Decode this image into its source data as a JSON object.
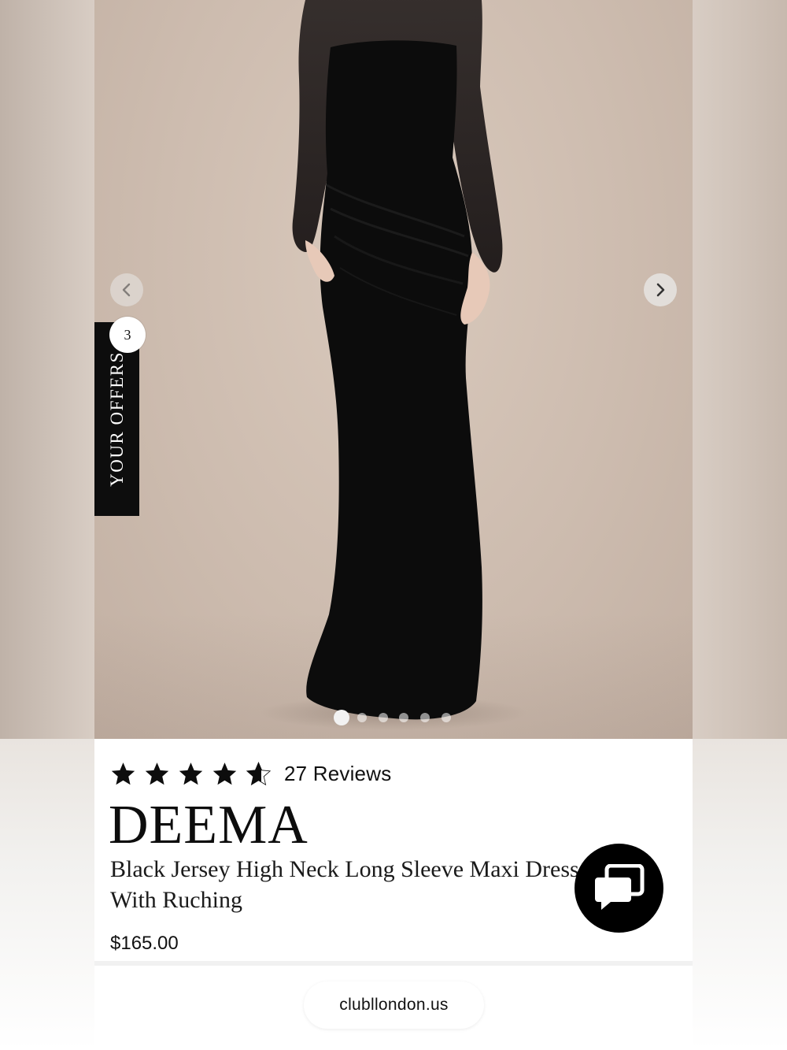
{
  "gallery": {
    "dots_total": 6,
    "active_index": 0
  },
  "offers": {
    "label": "YOUR OFFERS",
    "count": "3"
  },
  "product": {
    "rating": 4.5,
    "reviews_label": "27 Reviews",
    "brand": "DEEMA",
    "title": "Black Jersey High Neck Long Sleeve Maxi Dress With Ruching",
    "price": "$165.00"
  },
  "browser": {
    "url": "clubllondon.us"
  },
  "colors": {
    "dress": "#0c0c0c",
    "background": "#d4c3b6",
    "accent": "#000000"
  },
  "icons": {
    "prev": "chevron-left-icon",
    "next": "chevron-right-icon",
    "chat": "chat-bubbles-icon",
    "star": "star-icon"
  }
}
